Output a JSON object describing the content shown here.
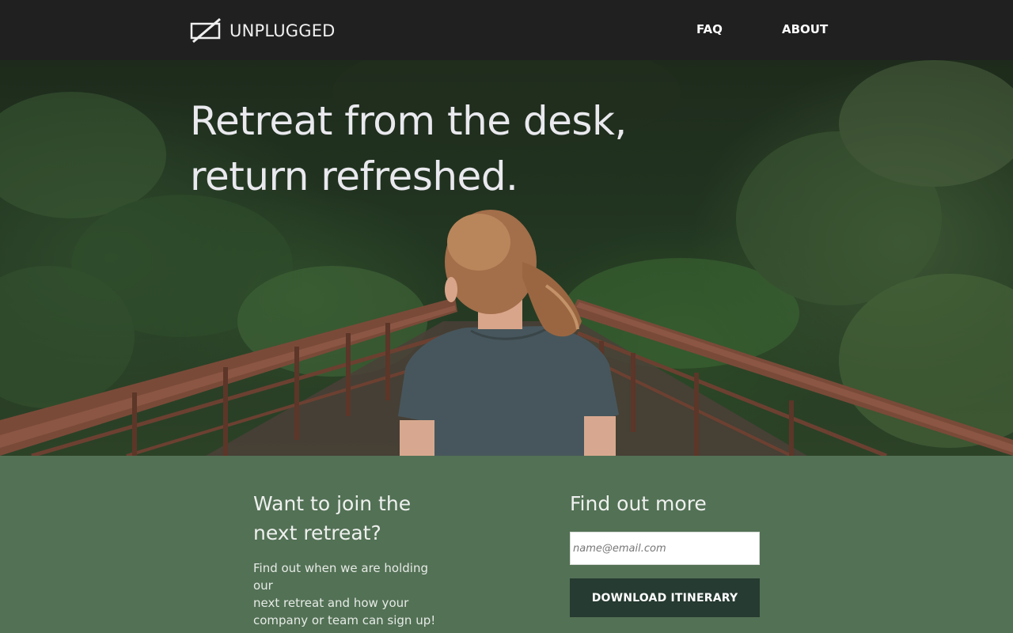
{
  "brand": {
    "name": "UNPLUGGED",
    "logo_icon": "unplugged-box-slash-icon"
  },
  "nav": {
    "items": [
      {
        "label": "FAQ"
      },
      {
        "label": "ABOUT"
      }
    ]
  },
  "hero": {
    "title_line1": "Retreat from the desk,",
    "title_line2": "return refreshed.",
    "image": "woman-on-forest-bridge-photo"
  },
  "cta": {
    "heading_line1": "Want to join the",
    "heading_line2": "next retreat?",
    "text_line1": "Find out when we are holding our",
    "text_line2": "next retreat and how your",
    "text_line3": "company or team can sign up!"
  },
  "signup": {
    "heading": "Find out more",
    "email_placeholder": "name@email.com",
    "email_value": "",
    "button_label": "DOWNLOAD ITINERARY"
  },
  "colors": {
    "header_bg": "#202020",
    "section_bg": "#537155",
    "button_bg": "#263b31",
    "text_light": "#e9e9ee"
  }
}
